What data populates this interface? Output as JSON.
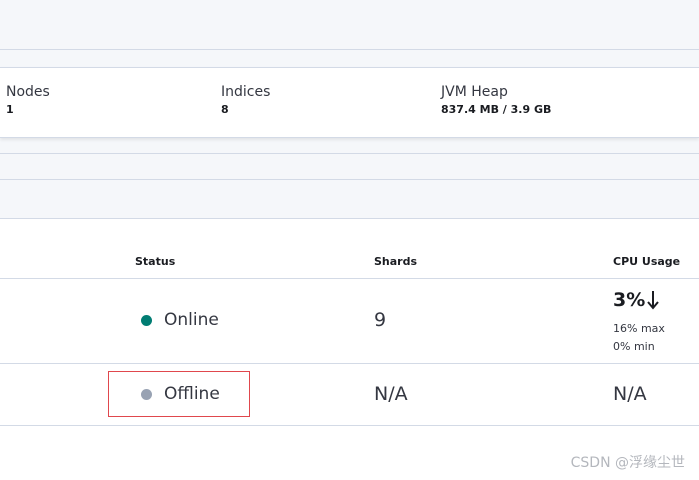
{
  "summary": {
    "nodes_label": "Nodes",
    "nodes_value": "1",
    "indices_label": "Indices",
    "indices_value": "8",
    "jvm_label": "JVM Heap",
    "jvm_value": "837.4 MB / 3.9 GB"
  },
  "table": {
    "headers": {
      "status": "Status",
      "shards": "Shards",
      "cpu": "CPU Usage"
    },
    "rows": [
      {
        "status": "Online",
        "status_color": "#017d73",
        "shards": "9",
        "cpu_value": "3%",
        "cpu_trend_icon": "arrow-down-icon",
        "cpu_max": "16% max",
        "cpu_min": "0% min"
      },
      {
        "status": "Offline",
        "status_color": "#98a2b3",
        "shards": "N/A",
        "cpu_value": "N/A"
      }
    ]
  },
  "watermark": "CSDN @浮缘尘世"
}
